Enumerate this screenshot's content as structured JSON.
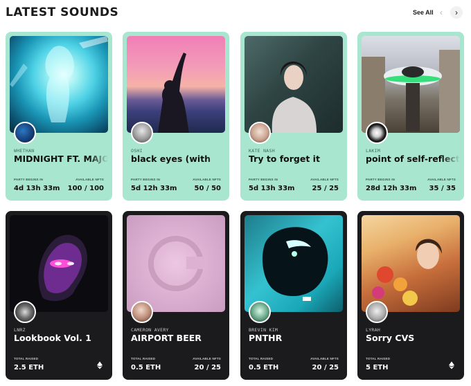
{
  "header": {
    "title": "LATEST SOUNDS",
    "see_all": "See All",
    "prev_icon": "chevron-left-icon",
    "next_icon": "chevron-right-icon"
  },
  "upcoming": [
    {
      "artist": "WHETHAN",
      "song": "MIDNIGHT FT. MAJOR",
      "label_left": "PARTY BEGINS IN",
      "value_left": "4d 13h 33m",
      "label_right": "AVAILABLE NFTS",
      "value_right": "100 / 100"
    },
    {
      "artist": "OSHI",
      "song": "black eyes (with",
      "label_left": "PARTY BEGINS IN",
      "value_left": "5d 12h 33m",
      "label_right": "AVAILABLE NFTS",
      "value_right": "50 / 50"
    },
    {
      "artist": "KATE NASH",
      "song": "Try to forget it",
      "label_left": "PARTY BEGINS IN",
      "value_left": "5d 13h 33m",
      "label_right": "AVAILABLE NFTS",
      "value_right": "25 / 25"
    },
    {
      "artist": "LAKIM",
      "song": "point of self-reflection",
      "label_left": "PARTY BEGINS IN",
      "value_left": "28d 12h 33m",
      "label_right": "AVAILABLE NFTS",
      "value_right": "35 / 35"
    }
  ],
  "released": [
    {
      "artist": "LNRZ",
      "song": "Lookbook Vol. 1",
      "label_left": "TOTAL RAISED",
      "value_left": "2.5 ETH",
      "label_right": "",
      "value_right": "",
      "badge_icon": "sound-logo-icon"
    },
    {
      "artist": "CAMERON AVERY",
      "song": "AIRPORT BEER",
      "label_left": "TOTAL RAISED",
      "value_left": "0.5 ETH",
      "label_right": "AVAILABLE NFTS",
      "value_right": "20 / 25"
    },
    {
      "artist": "BREVIN KIM",
      "song": "PNTHR",
      "label_left": "TOTAL RAISED",
      "value_left": "0.5 ETH",
      "label_right": "AVAILABLE NFTS",
      "value_right": "20 / 25"
    },
    {
      "artist": "LYRAH",
      "song": "Sorry CVS",
      "label_left": "TOTAL RAISED",
      "value_left": "5 ETH",
      "label_right": "",
      "value_right": "",
      "badge_icon": "sound-logo-icon"
    }
  ],
  "colors": {
    "mint_card": "#a9e6cf",
    "dark_card": "#1b1b1e",
    "background": "#ffffff"
  }
}
